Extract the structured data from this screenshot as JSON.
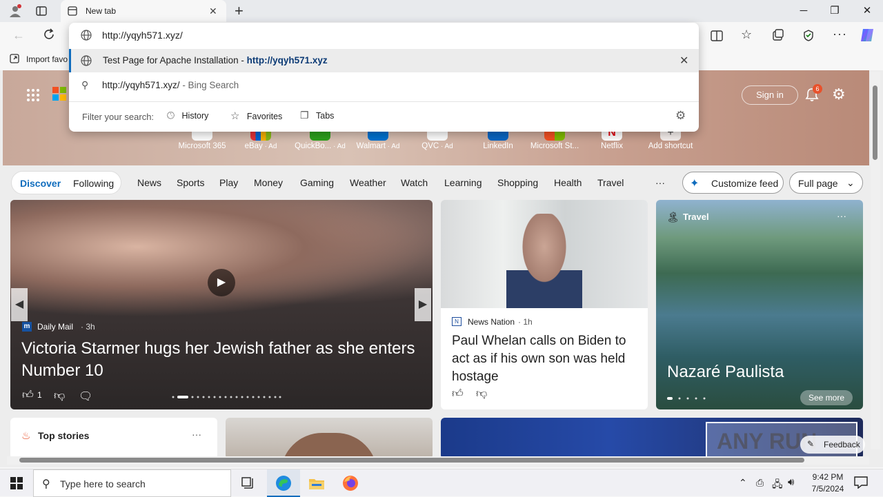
{
  "browser": {
    "tab_title": "New tab",
    "favorites_bar": {
      "import_label": "Import favo"
    }
  },
  "omnibox": {
    "typed_value": "http://yqyh571.xyz/",
    "suggestion_history_title": "Test Page for Apache Installation",
    "suggestion_history_sep": " - ",
    "suggestion_history_url": "http://yqyh571.xyz",
    "suggestion_search_text": "http://yqyh571.xyz/",
    "suggestion_search_suffix": " - Bing Search",
    "filter_label": "Filter your search:",
    "filters": [
      "History",
      "Favorites",
      "Tabs"
    ]
  },
  "newtab": {
    "sign_in": "Sign in",
    "notification_count": "6",
    "shortcuts": [
      {
        "label": "Microsoft 365",
        "ad": ""
      },
      {
        "label": "eBay",
        "ad": " · Ad"
      },
      {
        "label": "QuickBo...",
        "ad": " · Ad"
      },
      {
        "label": "Walmart",
        "ad": " · Ad"
      },
      {
        "label": "QVC",
        "ad": " · Ad"
      },
      {
        "label": "LinkedIn",
        "ad": ""
      },
      {
        "label": "Microsoft St...",
        "ad": ""
      },
      {
        "label": "Netflix",
        "ad": ""
      },
      {
        "label": "Add shortcut",
        "ad": ""
      }
    ],
    "feed_tabs": [
      "Discover",
      "Following"
    ],
    "categories": [
      "News",
      "Sports",
      "Play",
      "Money",
      "Gaming",
      "Weather",
      "Watch",
      "Learning",
      "Shopping",
      "Health",
      "Travel"
    ],
    "more": "···",
    "customize_feed": "Customize feed",
    "full_page": "Full page"
  },
  "cards": {
    "main": {
      "source": "Daily Mail",
      "age": "· 3h",
      "headline": "Victoria Starmer hugs her Jewish father as she enters Number 10",
      "likes": "1"
    },
    "news": {
      "source": "News Nation",
      "age": "· 1h",
      "headline": "Paul Whelan calls on Biden to act as if his own son was held hostage"
    },
    "travel": {
      "category": "Travel",
      "title": "Nazaré Paulista",
      "see_more": "See more"
    },
    "top_stories": {
      "title": "Top stories",
      "more": "···"
    }
  },
  "feedback": "Feedback",
  "watermark": "ANY RUN",
  "taskbar": {
    "search_placeholder": "Type here to search",
    "time": "9:42 PM",
    "date": "7/5/2024"
  },
  "colors": {
    "accent": "#0f6cbd",
    "url_link": "#0b3a75"
  }
}
